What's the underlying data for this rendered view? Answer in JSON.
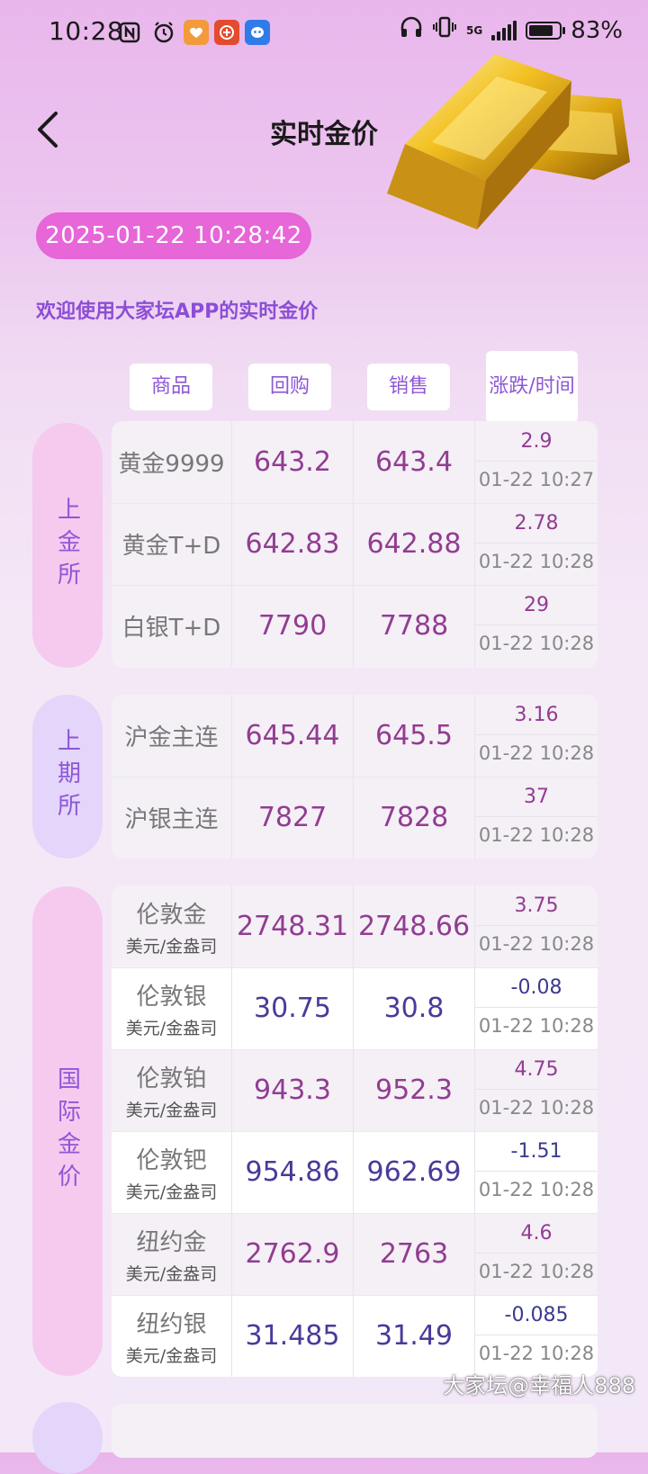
{
  "status_bar": {
    "time": "10:28",
    "network": "5G",
    "battery": "83%",
    "battery_level": 0.83
  },
  "header": {
    "title": "实时金价"
  },
  "datetime": "2025-01-22 10:28:42",
  "welcome": "欢迎使用大家坛APP的实时金价",
  "columns": [
    "商品",
    "回购",
    "销售",
    "涨跌/时间"
  ],
  "groups": [
    {
      "label": "上金所",
      "rows": [
        {
          "name": "黄金9999",
          "buy": "643.2",
          "sell": "643.4",
          "change": "2.9",
          "time": "01-22 10:27"
        },
        {
          "name": "黄金T+D",
          "buy": "642.83",
          "sell": "642.88",
          "change": "2.78",
          "time": "01-22 10:28"
        },
        {
          "name": "白银T+D",
          "buy": "7790",
          "sell": "7788",
          "change": "29",
          "time": "01-22 10:28"
        }
      ]
    },
    {
      "label": "上期所",
      "rows": [
        {
          "name": "沪金主连",
          "buy": "645.44",
          "sell": "645.5",
          "change": "3.16",
          "time": "01-22 10:28"
        },
        {
          "name": "沪银主连",
          "buy": "7827",
          "sell": "7828",
          "change": "37",
          "time": "01-22 10:28"
        }
      ]
    },
    {
      "label": "国际金价",
      "rows": [
        {
          "name": "伦敦金",
          "unit": "美元/金盎司",
          "buy": "2748.31",
          "sell": "2748.66",
          "change": "3.75",
          "time": "01-22 10:28"
        },
        {
          "name": "伦敦银",
          "unit": "美元/金盎司",
          "buy": "30.75",
          "sell": "30.8",
          "change": "-0.08",
          "time": "01-22 10:28"
        },
        {
          "name": "伦敦铂",
          "unit": "美元/金盎司",
          "buy": "943.3",
          "sell": "952.3",
          "change": "4.75",
          "time": "01-22 10:28"
        },
        {
          "name": "伦敦钯",
          "unit": "美元/金盎司",
          "buy": "954.86",
          "sell": "962.69",
          "change": "-1.51",
          "time": "01-22 10:28"
        },
        {
          "name": "纽约金",
          "unit": "美元/金盎司",
          "buy": "2762.9",
          "sell": "2763",
          "change": "4.6",
          "time": "01-22 10:28"
        },
        {
          "name": "纽约银",
          "unit": "美元/金盎司",
          "buy": "31.485",
          "sell": "31.49",
          "change": "-0.085",
          "time": "01-22 10:28"
        }
      ]
    }
  ],
  "watermark": "大家坛@幸福人888",
  "colors": {
    "accent_pink": "#e766d8",
    "label_purple": "#8e57d6",
    "up_color": "#923c92",
    "down_color": "#3c3a8e"
  }
}
